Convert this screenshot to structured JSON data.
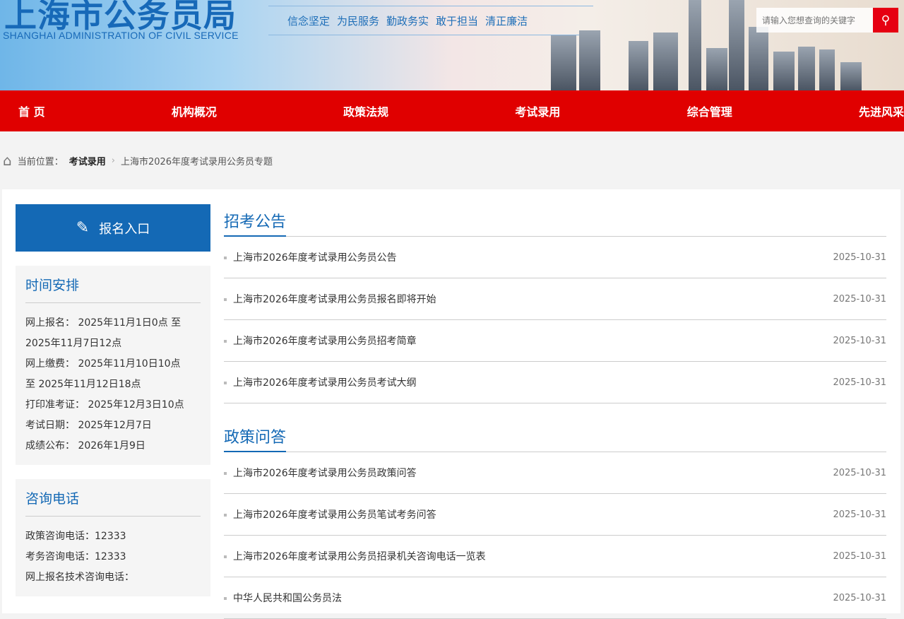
{
  "header": {
    "logo_cn": "上海市公务员局",
    "logo_en": "SHANGHAI ADMINISTRATION OF CIVIL SERVICE",
    "slogans": [
      "信念坚定",
      "为民服务",
      "勤政务实",
      "敢于担当",
      "清正廉洁"
    ],
    "search_placeholder": "请输入您想查询的关键字"
  },
  "nav": [
    "首 页",
    "机构概况",
    "政策法规",
    "考试录用",
    "综合管理",
    "先进风采"
  ],
  "breadcrumb": {
    "label": "当前位置：",
    "section": "考试录用",
    "page": "上海市2026年度考试录用公务员专题"
  },
  "sidebar": {
    "signup": "报名入口",
    "schedule": {
      "title": "时间安排",
      "lines": [
        "网上报名： 2025年11月1日0点 至",
        "2025年11月7日12点",
        "网上缴费： 2025年11月10日10点",
        "至 2025年11月12日18点",
        "打印准考证： 2025年12月3日10点",
        "考试日期： 2025年12月7日",
        "成绩公布： 2026年1月9日"
      ]
    },
    "contact": {
      "title": "咨询电话",
      "lines": [
        "政策咨询电话：12333",
        "考务咨询电话：12333",
        "网上报名技术咨询电话："
      ]
    }
  },
  "sections": [
    {
      "title": "招考公告",
      "items": [
        {
          "t": "上海市2026年度考试录用公务员公告",
          "d": "2025-10-31"
        },
        {
          "t": "上海市2026年度考试录用公务员报名即将开始",
          "d": "2025-10-31"
        },
        {
          "t": "上海市2026年度考试录用公务员招考简章",
          "d": "2025-10-31"
        },
        {
          "t": "上海市2026年度考试录用公务员考试大纲",
          "d": "2025-10-31"
        }
      ]
    },
    {
      "title": "政策问答",
      "items": [
        {
          "t": "上海市2026年度考试录用公务员政策问答",
          "d": "2025-10-31"
        },
        {
          "t": "上海市2026年度考试录用公务员笔试考务问答",
          "d": "2025-10-31"
        },
        {
          "t": "上海市2026年度考试录用公务员招录机关咨询电话一览表",
          "d": "2025-10-31"
        },
        {
          "t": "中华人民共和国公务员法",
          "d": "2025-10-31"
        }
      ]
    }
  ]
}
